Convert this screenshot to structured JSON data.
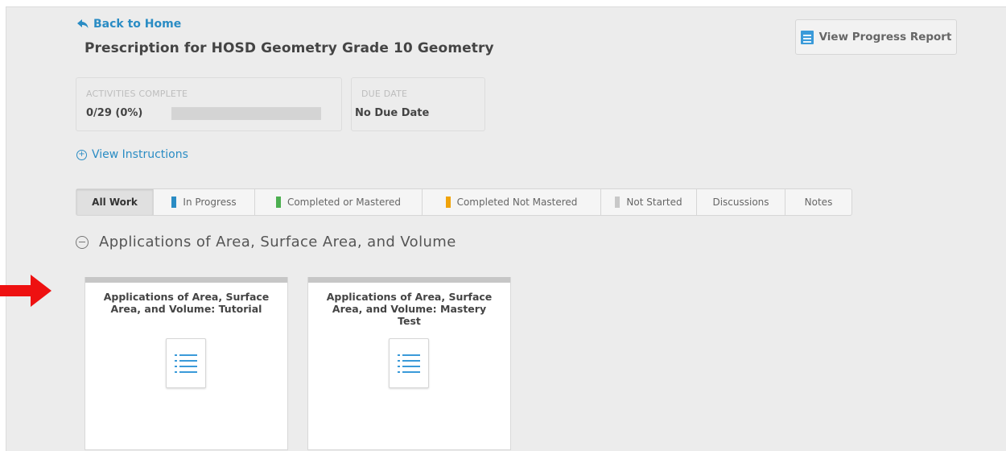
{
  "header": {
    "back_label": "Back to Home",
    "title": "Prescription for HOSD Geometry Grade 10 Geometry",
    "report_button": "View Progress Report"
  },
  "stats": {
    "activities_label": "ACTIVITIES COMPLETE",
    "activities_value": "0/29 (0%)",
    "progress_fraction": 0,
    "due_label": "DUE DATE",
    "due_value": "No Due Date"
  },
  "instructions_label": "View Instructions",
  "tabs": [
    {
      "label": "All Work",
      "active": true
    },
    {
      "label": "In Progress",
      "swatch": "#2a8cc4"
    },
    {
      "label": "Completed or Mastered",
      "swatch": "#4caf50"
    },
    {
      "label": "Completed Not Mastered",
      "swatch": "#f0a30a"
    },
    {
      "label": "Not Started",
      "swatch": "#c8c8c8"
    },
    {
      "label": "Discussions"
    },
    {
      "label": "Notes"
    }
  ],
  "section": {
    "title": "Applications of Area, Surface Area, and Volume"
  },
  "cards": [
    {
      "title": "Applications of Area, Surface Area, and Volume: Tutorial",
      "icon": "list-icon"
    },
    {
      "title": "Applications of Area, Surface Area, and Volume: Mastery Test",
      "icon": "list-icon"
    }
  ],
  "colors": {
    "accent": "#2a8cc4",
    "annotation_arrow": "#ee1111"
  }
}
